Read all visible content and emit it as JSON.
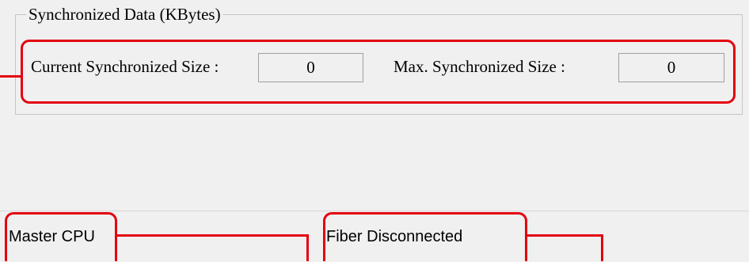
{
  "groupbox": {
    "title": "Synchronized Data (KBytes)"
  },
  "fields": {
    "current_label": "Current Synchronized Size :",
    "current_value": "0",
    "max_label": "Max. Synchronized Size :",
    "max_value": "0"
  },
  "statusbar": {
    "role": "Master CPU",
    "fiber": "Fiber Disconnected"
  },
  "colors": {
    "annotation": "#e3000f",
    "background": "#f0f0f0",
    "border": "#a0a0a0"
  }
}
